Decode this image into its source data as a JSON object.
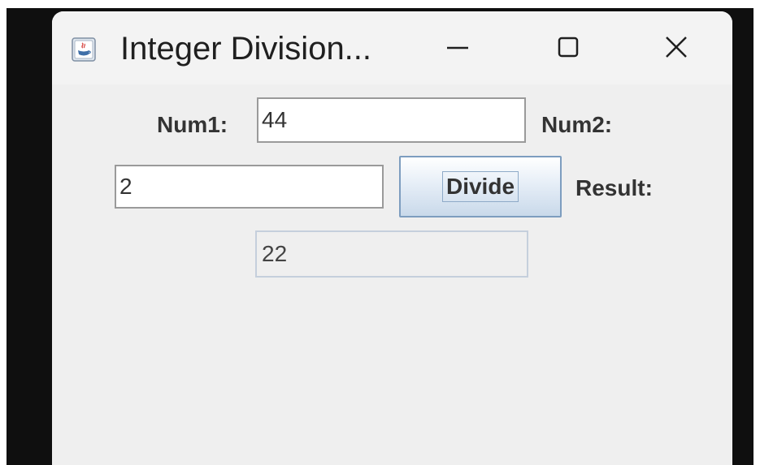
{
  "window": {
    "title": "Integer Division...",
    "controls": {
      "minimize": "minimize-icon",
      "maximize": "maximize-icon",
      "close": "close-icon"
    },
    "app_icon": "java-app-icon"
  },
  "form": {
    "num1_label": "Num1:",
    "num1_value": "44",
    "num2_label": "Num2:",
    "num2_value": "2",
    "divide_label": "Divide",
    "result_label": "Result:",
    "result_value": "22"
  },
  "colors": {
    "window_bg": "#efefef",
    "titlebar_bg": "#f3f3f3",
    "button_border": "#7d9dbf",
    "field_border": "#9a9a9a",
    "readonly_border": "#c5cfdc"
  }
}
